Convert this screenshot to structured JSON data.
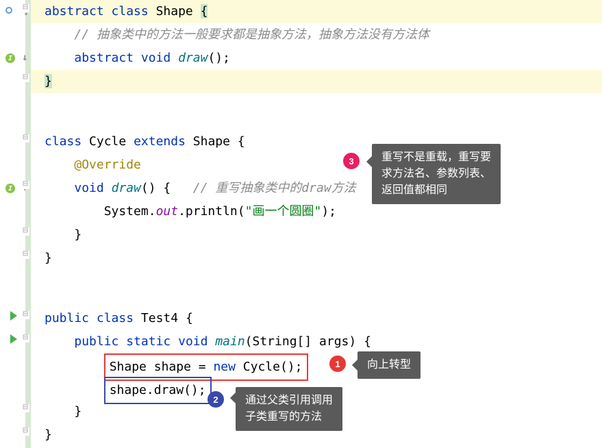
{
  "code": {
    "l1_kw1": "abstract",
    "l1_kw2": "class",
    "l1_cls": "Shape",
    "l1_brace": "{",
    "l2_com": "// 抽象类中的方法一般要求都是抽象方法，抽象方法没有方法体",
    "l3_kw1": "abstract",
    "l3_kw2": "void",
    "l3_mth": "draw",
    "l3_end": "();",
    "l4_brace": "}",
    "l5_kw1": "class",
    "l5_cls1": "Cycle",
    "l5_kw2": "extends",
    "l5_cls2": "Shape",
    "l5_brace": "{",
    "l6_ann": "@Override",
    "l7_kw": "void",
    "l7_mth": "draw",
    "l7_paren": "() {",
    "l7_com": "// 重写抽象类中的draw方法",
    "l8_sys": "System.",
    "l8_out": "out",
    "l8_pln": ".println(",
    "l8_str": "\"画一个圆圈\"",
    "l8_end": ");",
    "l9_brace": "}",
    "l10_brace": "}",
    "l11_kw1": "public",
    "l11_kw2": "class",
    "l11_cls": "Test4",
    "l11_brace": "{",
    "l12_kw1": "public",
    "l12_kw2": "static",
    "l12_kw3": "void",
    "l12_mth": "main",
    "l12_paren": "(String[] args) {",
    "l13_cls1": "Shape",
    "l13_var": " shape = ",
    "l13_kw": "new",
    "l13_cls2": " Cycle();",
    "l14_call": "shape.draw();",
    "l15_brace": "}",
    "l16_brace": "}"
  },
  "callouts": {
    "c1": "向上转型",
    "c2_l1": "通过父类引用调用",
    "c2_l2": "子类重写的方法",
    "c3_l1": "重写不是重载，重写要",
    "c3_l2": "求方法名、参数列表、",
    "c3_l3": "返回值都相同"
  },
  "badges": {
    "b1": "1",
    "b2": "2",
    "b3": "3"
  }
}
